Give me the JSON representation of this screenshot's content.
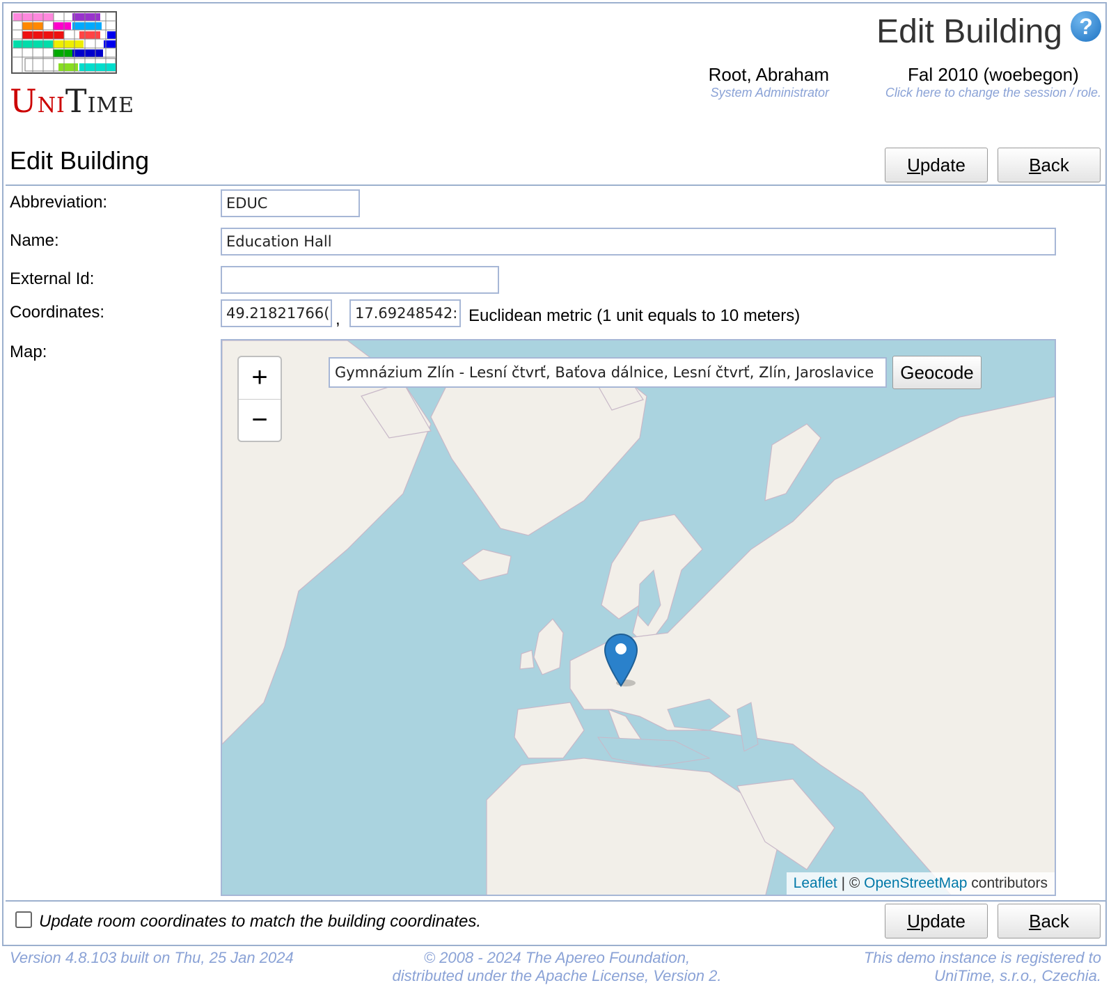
{
  "header": {
    "app_name": "UniTime",
    "page_title": "Edit Building",
    "user_name": "Root, Abraham",
    "user_role": "System Administrator",
    "session_name": "Fal 2010 (woebegon)",
    "session_hint": "Click here to change the session / role."
  },
  "section": {
    "title": "Edit Building",
    "update_prefix": "U",
    "update_rest": "pdate",
    "back_prefix": "B",
    "back_rest": "ack"
  },
  "form": {
    "abbreviation_label": "Abbreviation:",
    "abbreviation_value": "EDUC",
    "name_label": "Name:",
    "name_value": "Education Hall",
    "external_id_label": "External Id:",
    "external_id_value": "",
    "coordinates_label": "Coordinates:",
    "coord_lat": "49.21821766(",
    "coord_sep": ",",
    "coord_lng": "17.69248542:",
    "metric_text": "Euclidean metric (1 unit equals to 10 meters)",
    "map_label": "Map:"
  },
  "map": {
    "zoom_in": "+",
    "zoom_out": "−",
    "geocode_value": "Gymnázium Zlín - Lesní čtvrť, Baťova dálnice, Lesní čtvrť, Zlín, Jaroslavice",
    "geocode_button": "Geocode",
    "attribution_leaflet": "Leaflet",
    "attribution_sep": " | © ",
    "attribution_osm": "OpenStreetMap",
    "attribution_tail": " contributors",
    "colors": {
      "water": "#aad3df",
      "land": "#f2efe9",
      "marker": "#2a81cb"
    }
  },
  "bottom": {
    "checkbox_label": "Update room coordinates to match the building coordinates."
  },
  "footer": {
    "version": "Version 4.8.103 built on Thu, 25 Jan 2024",
    "copyright_1": "© 2008 - 2024 The Apereo Foundation,",
    "copyright_2": "distributed under the Apache License, Version 2.",
    "registered_1": "This demo instance is registered to",
    "registered_2": "UniTime, s.r.o., Czechia."
  }
}
